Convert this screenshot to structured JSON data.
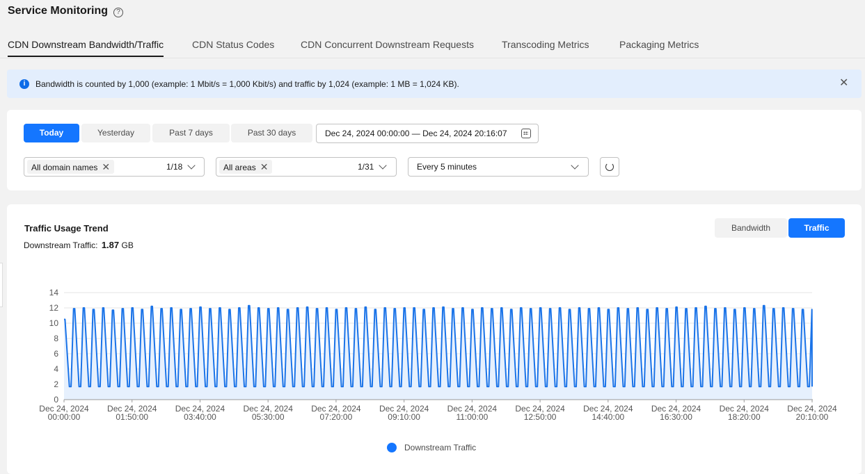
{
  "header": {
    "title": "Service Monitoring",
    "help_glyph": "?",
    "tabs": [
      {
        "label": "CDN Downstream Bandwidth/Traffic",
        "active": true
      },
      {
        "label": "CDN Status Codes",
        "active": false
      },
      {
        "label": "CDN Concurrent Downstream Requests",
        "active": false
      },
      {
        "label": "Transcoding Metrics",
        "active": false
      },
      {
        "label": "Packaging Metrics",
        "active": false
      }
    ]
  },
  "notice": {
    "icon": "info-icon",
    "icon_glyph": "i",
    "text": "Bandwidth is counted by 1,000 (example: 1 Mbit/s = 1,000 Kbit/s) and traffic by 1,024 (example: 1 MB = 1,024 KB).",
    "close_glyph": "✕"
  },
  "filters": {
    "time_buttons": [
      {
        "label": "Today",
        "active": true
      },
      {
        "label": "Yesterday",
        "active": false
      },
      {
        "label": "Past 7 days",
        "active": false
      },
      {
        "label": "Past 30 days",
        "active": false
      }
    ],
    "date_range": "Dec 24, 2024 00:00:00 — Dec 24, 2024 20:16:07",
    "domain_select": {
      "chip": "All domain names",
      "count": "1/18"
    },
    "area_select": {
      "chip": "All areas",
      "count": "1/31"
    },
    "interval_select": {
      "value": "Every 5 minutes"
    },
    "chip_close_glyph": "✕"
  },
  "chart_panel": {
    "title": "Traffic Usage Trend",
    "summary_label": "Downstream Traffic:",
    "summary_value": "1.87",
    "summary_unit": "GB",
    "toggle": [
      {
        "label": "Bandwidth",
        "active": false
      },
      {
        "label": "Traffic",
        "active": true
      }
    ]
  },
  "colors": {
    "accent": "#1476ff",
    "line": "#1a73e8",
    "area": "#e6f0fd"
  },
  "chart_data": {
    "type": "area",
    "title": "",
    "xlabel": "",
    "ylabel": "",
    "ylim": [
      0,
      14
    ],
    "yticks": [
      0,
      2,
      4,
      6,
      8,
      10,
      12,
      14
    ],
    "x_ticks": [
      [
        "Dec 24, 2024",
        "00:00:00"
      ],
      [
        "Dec 24, 2024",
        "01:50:00"
      ],
      [
        "Dec 24, 2024",
        "03:40:00"
      ],
      [
        "Dec 24, 2024",
        "05:30:00"
      ],
      [
        "Dec 24, 2024",
        "07:20:00"
      ],
      [
        "Dec 24, 2024",
        "09:10:00"
      ],
      [
        "Dec 24, 2024",
        "11:00:00"
      ],
      [
        "Dec 24, 2024",
        "12:50:00"
      ],
      [
        "Dec 24, 2024",
        "14:40:00"
      ],
      [
        "Dec 24, 2024",
        "16:30:00"
      ],
      [
        "Dec 24, 2024",
        "18:20:00"
      ],
      [
        "Dec 24, 2024",
        "20:10:00"
      ]
    ],
    "x_start": "Dec 24, 2024 00:00:00",
    "x_end": "Dec 24, 2024 20:10:00",
    "grid": true,
    "legend_position": "bottom-center",
    "series": [
      {
        "name": "Downstream Traffic",
        "pattern": "periodic sawtooth, about 77 cycles over the day",
        "peak_values_approx": [
          10.5,
          11.9,
          12.0,
          11.8,
          12.0,
          11.7,
          11.9,
          12.0,
          11.8,
          12.2,
          11.9,
          12.0,
          11.8,
          11.9,
          12.1,
          11.9,
          12.0,
          11.8,
          12.0,
          12.3,
          12.0,
          11.9,
          12.0,
          11.8,
          12.0,
          12.1,
          11.9,
          12.0,
          11.8,
          12.0,
          11.9,
          12.1,
          11.8,
          12.0,
          11.9,
          12.0,
          12.0,
          11.8,
          12.0,
          12.1,
          11.9,
          12.0,
          11.8,
          12.0,
          11.9,
          12.0,
          11.8,
          12.0,
          11.9,
          12.0,
          11.9,
          12.0,
          11.8,
          12.0,
          11.9,
          12.0,
          11.8,
          12.0,
          11.9,
          12.0,
          11.8,
          12.0,
          11.9,
          12.1,
          11.9,
          12.0,
          12.2,
          11.9,
          12.0,
          11.8,
          12.0,
          11.9,
          12.3,
          11.9,
          12.0,
          11.9,
          11.8
        ],
        "trough_value_approx": 1.7
      }
    ]
  }
}
